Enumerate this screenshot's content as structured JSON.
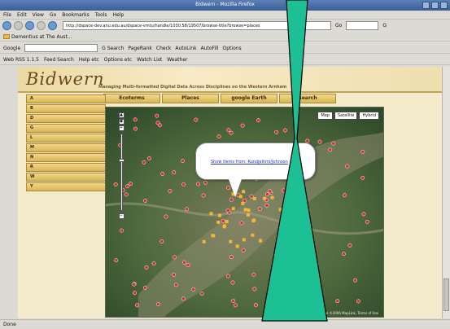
{
  "window": {
    "title": "Bidwern - Mozilla Firefox"
  },
  "menu": [
    "File",
    "Edit",
    "View",
    "Go",
    "Bookmarks",
    "Tools",
    "Help"
  ],
  "nav": {
    "url": "http://dspace-dev.anu.edu.au/dspace-vmtu/handle/1030.58/19507/browse-title?browse=places",
    "go_label": "Go",
    "search_label": "G"
  },
  "bookmarks": {
    "item": "Dementius at The Aust..."
  },
  "google_bar": {
    "label": "Google",
    "buttons": [
      "G Search",
      "PageRank",
      "Check",
      "AutoLink",
      "AutoFill",
      "Options"
    ]
  },
  "tools_bar": {
    "items": [
      "Web RSS 1.1.5",
      "Feed Search",
      "Help etc",
      "Options etc",
      "Watch List",
      "Weather"
    ]
  },
  "site": {
    "logo": "Bidwern",
    "tagline": "Managing Multi-formatted Digital Data Across Disciplines on the Western Arnhem",
    "tabs": [
      "Ecoterms",
      "Places",
      "google Earth",
      "Search"
    ],
    "letters": [
      "A",
      "B",
      "D",
      "G",
      "L",
      "M",
      "N",
      "R",
      "W",
      "Y"
    ]
  },
  "map": {
    "types": [
      "Map",
      "Satellite",
      "Hybrid"
    ],
    "popup_link": "Show Items from: Kundjeihmi/Johnson",
    "copyright": "Imagery ©2006 TerraMetrics, Map data ©2006 MapLink, Terms of Use"
  },
  "status": "Done",
  "colors": {
    "accent": "#d9b453",
    "overlay": "#1dbf94",
    "marker": "#d63031",
    "marker_highlight": "#f5b731"
  }
}
